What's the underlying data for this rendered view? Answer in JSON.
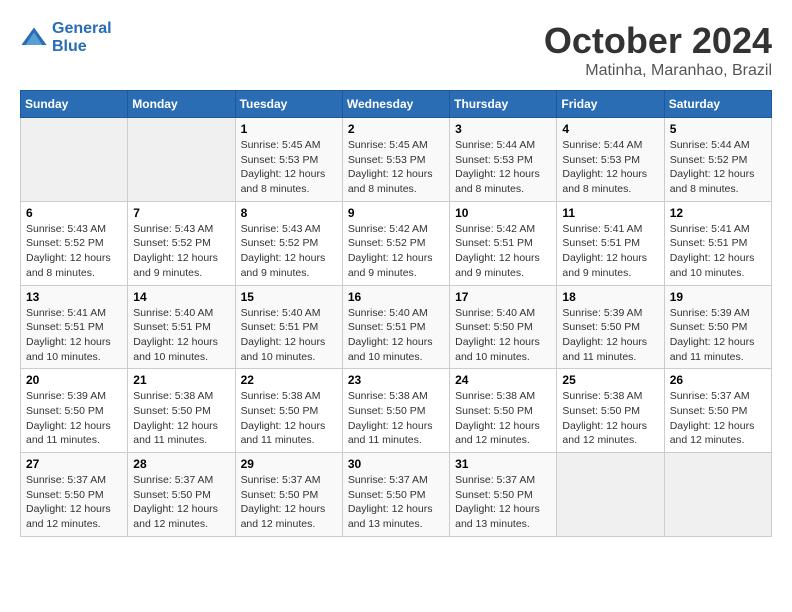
{
  "logo": {
    "line1": "General",
    "line2": "Blue"
  },
  "header": {
    "month": "October 2024",
    "location": "Matinha, Maranhao, Brazil"
  },
  "weekdays": [
    "Sunday",
    "Monday",
    "Tuesday",
    "Wednesday",
    "Thursday",
    "Friday",
    "Saturday"
  ],
  "weeks": [
    [
      {
        "day": "",
        "info": ""
      },
      {
        "day": "",
        "info": ""
      },
      {
        "day": "1",
        "info": "Sunrise: 5:45 AM\nSunset: 5:53 PM\nDaylight: 12 hours and 8 minutes."
      },
      {
        "day": "2",
        "info": "Sunrise: 5:45 AM\nSunset: 5:53 PM\nDaylight: 12 hours and 8 minutes."
      },
      {
        "day": "3",
        "info": "Sunrise: 5:44 AM\nSunset: 5:53 PM\nDaylight: 12 hours and 8 minutes."
      },
      {
        "day": "4",
        "info": "Sunrise: 5:44 AM\nSunset: 5:53 PM\nDaylight: 12 hours and 8 minutes."
      },
      {
        "day": "5",
        "info": "Sunrise: 5:44 AM\nSunset: 5:52 PM\nDaylight: 12 hours and 8 minutes."
      }
    ],
    [
      {
        "day": "6",
        "info": "Sunrise: 5:43 AM\nSunset: 5:52 PM\nDaylight: 12 hours and 8 minutes."
      },
      {
        "day": "7",
        "info": "Sunrise: 5:43 AM\nSunset: 5:52 PM\nDaylight: 12 hours and 9 minutes."
      },
      {
        "day": "8",
        "info": "Sunrise: 5:43 AM\nSunset: 5:52 PM\nDaylight: 12 hours and 9 minutes."
      },
      {
        "day": "9",
        "info": "Sunrise: 5:42 AM\nSunset: 5:52 PM\nDaylight: 12 hours and 9 minutes."
      },
      {
        "day": "10",
        "info": "Sunrise: 5:42 AM\nSunset: 5:51 PM\nDaylight: 12 hours and 9 minutes."
      },
      {
        "day": "11",
        "info": "Sunrise: 5:41 AM\nSunset: 5:51 PM\nDaylight: 12 hours and 9 minutes."
      },
      {
        "day": "12",
        "info": "Sunrise: 5:41 AM\nSunset: 5:51 PM\nDaylight: 12 hours and 10 minutes."
      }
    ],
    [
      {
        "day": "13",
        "info": "Sunrise: 5:41 AM\nSunset: 5:51 PM\nDaylight: 12 hours and 10 minutes."
      },
      {
        "day": "14",
        "info": "Sunrise: 5:40 AM\nSunset: 5:51 PM\nDaylight: 12 hours and 10 minutes."
      },
      {
        "day": "15",
        "info": "Sunrise: 5:40 AM\nSunset: 5:51 PM\nDaylight: 12 hours and 10 minutes."
      },
      {
        "day": "16",
        "info": "Sunrise: 5:40 AM\nSunset: 5:51 PM\nDaylight: 12 hours and 10 minutes."
      },
      {
        "day": "17",
        "info": "Sunrise: 5:40 AM\nSunset: 5:50 PM\nDaylight: 12 hours and 10 minutes."
      },
      {
        "day": "18",
        "info": "Sunrise: 5:39 AM\nSunset: 5:50 PM\nDaylight: 12 hours and 11 minutes."
      },
      {
        "day": "19",
        "info": "Sunrise: 5:39 AM\nSunset: 5:50 PM\nDaylight: 12 hours and 11 minutes."
      }
    ],
    [
      {
        "day": "20",
        "info": "Sunrise: 5:39 AM\nSunset: 5:50 PM\nDaylight: 12 hours and 11 minutes."
      },
      {
        "day": "21",
        "info": "Sunrise: 5:38 AM\nSunset: 5:50 PM\nDaylight: 12 hours and 11 minutes."
      },
      {
        "day": "22",
        "info": "Sunrise: 5:38 AM\nSunset: 5:50 PM\nDaylight: 12 hours and 11 minutes."
      },
      {
        "day": "23",
        "info": "Sunrise: 5:38 AM\nSunset: 5:50 PM\nDaylight: 12 hours and 11 minutes."
      },
      {
        "day": "24",
        "info": "Sunrise: 5:38 AM\nSunset: 5:50 PM\nDaylight: 12 hours and 12 minutes."
      },
      {
        "day": "25",
        "info": "Sunrise: 5:38 AM\nSunset: 5:50 PM\nDaylight: 12 hours and 12 minutes."
      },
      {
        "day": "26",
        "info": "Sunrise: 5:37 AM\nSunset: 5:50 PM\nDaylight: 12 hours and 12 minutes."
      }
    ],
    [
      {
        "day": "27",
        "info": "Sunrise: 5:37 AM\nSunset: 5:50 PM\nDaylight: 12 hours and 12 minutes."
      },
      {
        "day": "28",
        "info": "Sunrise: 5:37 AM\nSunset: 5:50 PM\nDaylight: 12 hours and 12 minutes."
      },
      {
        "day": "29",
        "info": "Sunrise: 5:37 AM\nSunset: 5:50 PM\nDaylight: 12 hours and 12 minutes."
      },
      {
        "day": "30",
        "info": "Sunrise: 5:37 AM\nSunset: 5:50 PM\nDaylight: 12 hours and 13 minutes."
      },
      {
        "day": "31",
        "info": "Sunrise: 5:37 AM\nSunset: 5:50 PM\nDaylight: 12 hours and 13 minutes."
      },
      {
        "day": "",
        "info": ""
      },
      {
        "day": "",
        "info": ""
      }
    ]
  ]
}
